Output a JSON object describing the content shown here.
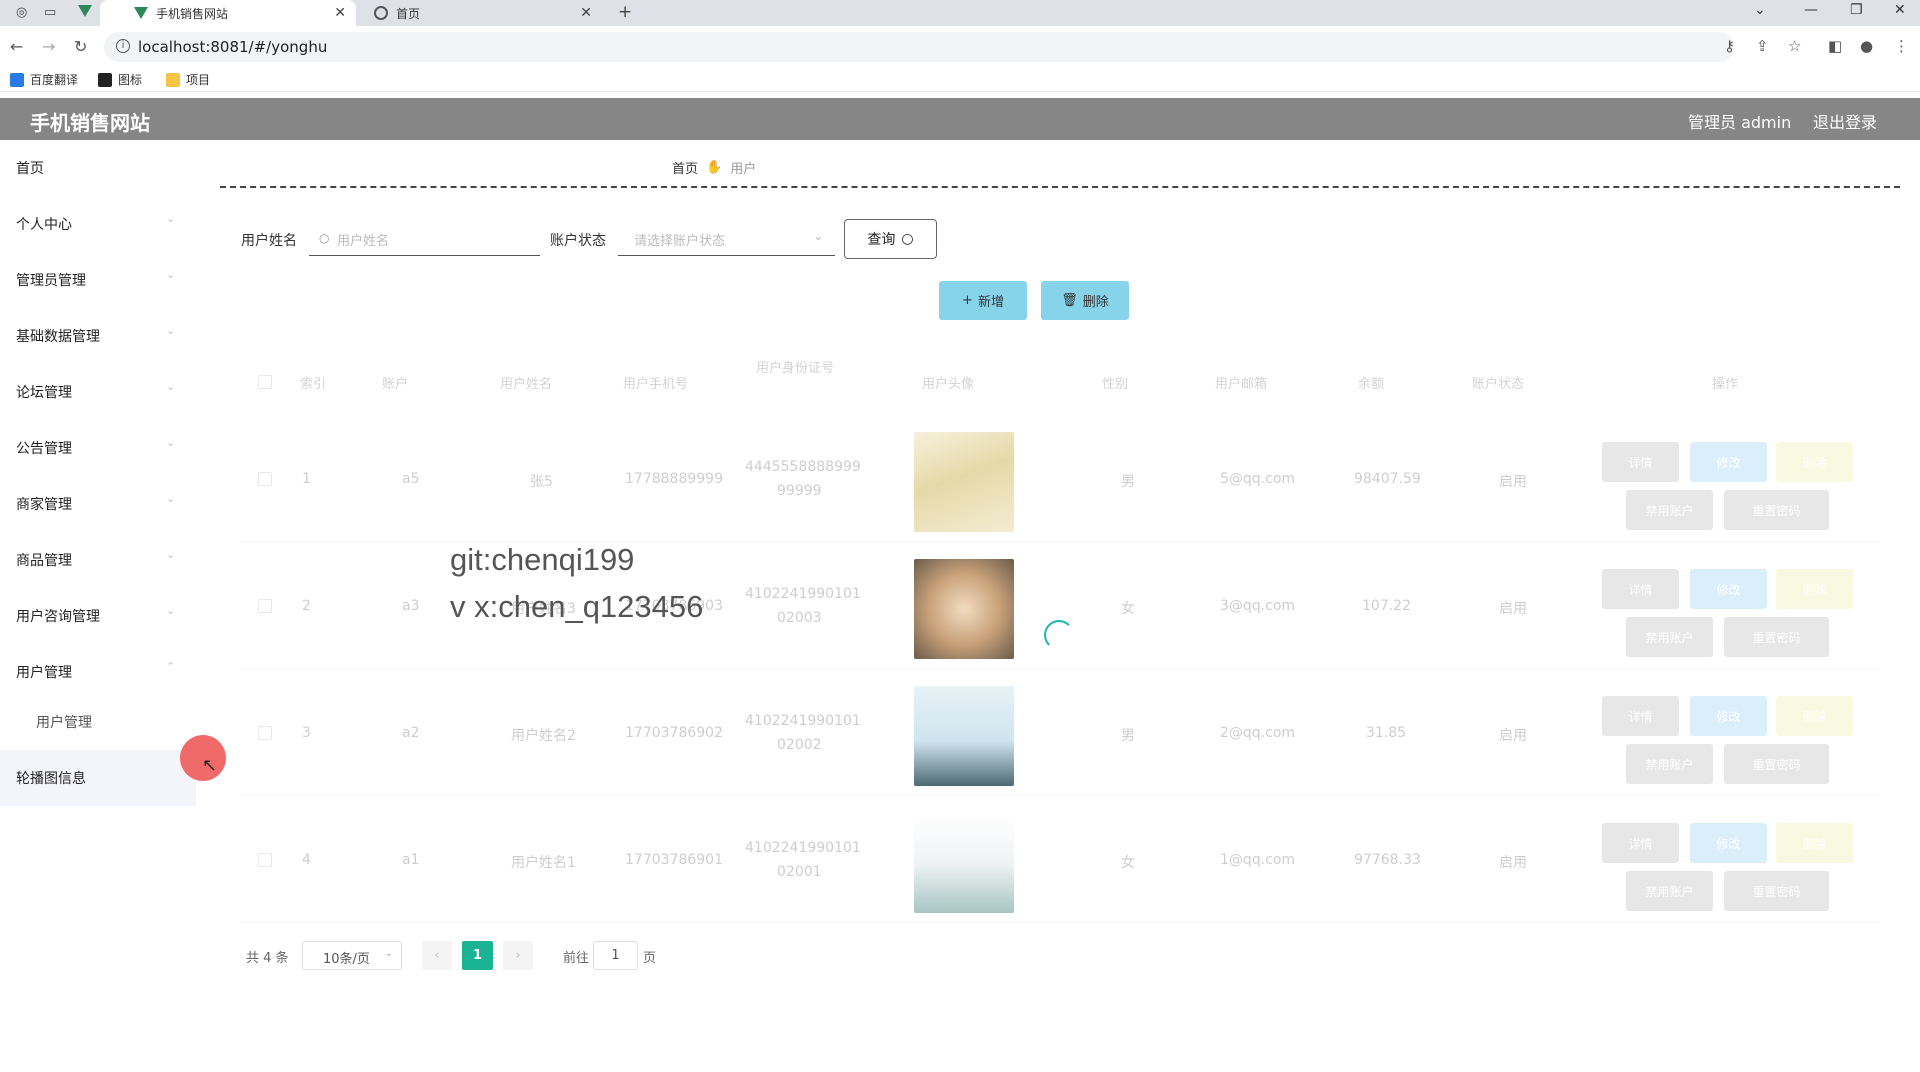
{
  "browser": {
    "tabs": [
      {
        "title": "手机销售网站",
        "active": true
      },
      {
        "title": "首页",
        "active": false
      }
    ],
    "new_tab": "+",
    "url": "localhost:8081/#/yonghu",
    "bookmarks": [
      "百度翻译",
      "图标",
      "项目"
    ]
  },
  "header": {
    "title": "手机销售网站",
    "admin": "管理员 admin",
    "logout": "退出登录"
  },
  "sidebar": {
    "items": [
      {
        "label": "首页",
        "has_arrow": false
      },
      {
        "label": "个人中心",
        "has_arrow": true
      },
      {
        "label": "管理员管理",
        "has_arrow": true
      },
      {
        "label": "基础数据管理",
        "has_arrow": true
      },
      {
        "label": "论坛管理",
        "has_arrow": true
      },
      {
        "label": "公告管理",
        "has_arrow": true
      },
      {
        "label": "商家管理",
        "has_arrow": true
      },
      {
        "label": "商品管理",
        "has_arrow": true
      },
      {
        "label": "用户咨询管理",
        "has_arrow": true
      },
      {
        "label": "用户管理",
        "has_arrow": true,
        "expanded": true
      },
      {
        "label": "用户管理",
        "sub": true
      },
      {
        "label": "轮播图信息",
        "has_arrow": true
      }
    ]
  },
  "breadcrumb": {
    "home": "首页",
    "current": "用户"
  },
  "search": {
    "name_label": "用户姓名",
    "name_placeholder": "用户姓名",
    "status_label": "账户状态",
    "status_placeholder": "请选择账户状态",
    "query_button": "查询"
  },
  "actions": {
    "add": "新增",
    "delete": "删除"
  },
  "table": {
    "headers": [
      "索引",
      "账户",
      "用户姓名",
      "用户手机号",
      "用户身份证号",
      "用户头像",
      "性别",
      "用户邮箱",
      "余额",
      "账户状态",
      "操作"
    ],
    "rows": [
      {
        "index": "1",
        "account": "a5",
        "name": "张5",
        "phone": "17788889999",
        "id_line1": "4445558888999",
        "id_line2": "99999",
        "gender": "男",
        "email": "5@qq.com",
        "balance": "98407.59",
        "status": "启用"
      },
      {
        "index": "2",
        "account": "a3",
        "name": "用户姓名3",
        "phone": "17703786903",
        "id_line1": "4102241990101",
        "id_line2": "02003",
        "gender": "女",
        "email": "3@qq.com",
        "balance": "107.22",
        "status": "启用"
      },
      {
        "index": "3",
        "account": "a2",
        "name": "用户姓名2",
        "phone": "17703786902",
        "id_line1": "4102241990101",
        "id_line2": "02002",
        "gender": "男",
        "email": "2@qq.com",
        "balance": "31.85",
        "status": "启用"
      },
      {
        "index": "4",
        "account": "a1",
        "name": "用户姓名1",
        "phone": "17703786901",
        "id_line1": "4102241990101",
        "id_line2": "02001",
        "gender": "女",
        "email": "1@qq.com",
        "balance": "97768.33",
        "status": "启用"
      }
    ],
    "ops": {
      "detail": "详情",
      "edit": "修改",
      "remove": "删除",
      "disable": "禁用账户",
      "reset": "重置密码"
    }
  },
  "watermark": {
    "line1": "git:chenqi199",
    "line2": "v x:chen_q123456"
  },
  "pagination": {
    "total": "共 4 条",
    "page_size": "10条/页",
    "current": "1",
    "goto_label": "前往",
    "goto_value": "1",
    "page_suffix": "页"
  },
  "colors": {
    "header": "#868686",
    "button": "#86d3ea",
    "page_active": "#1ab394"
  }
}
